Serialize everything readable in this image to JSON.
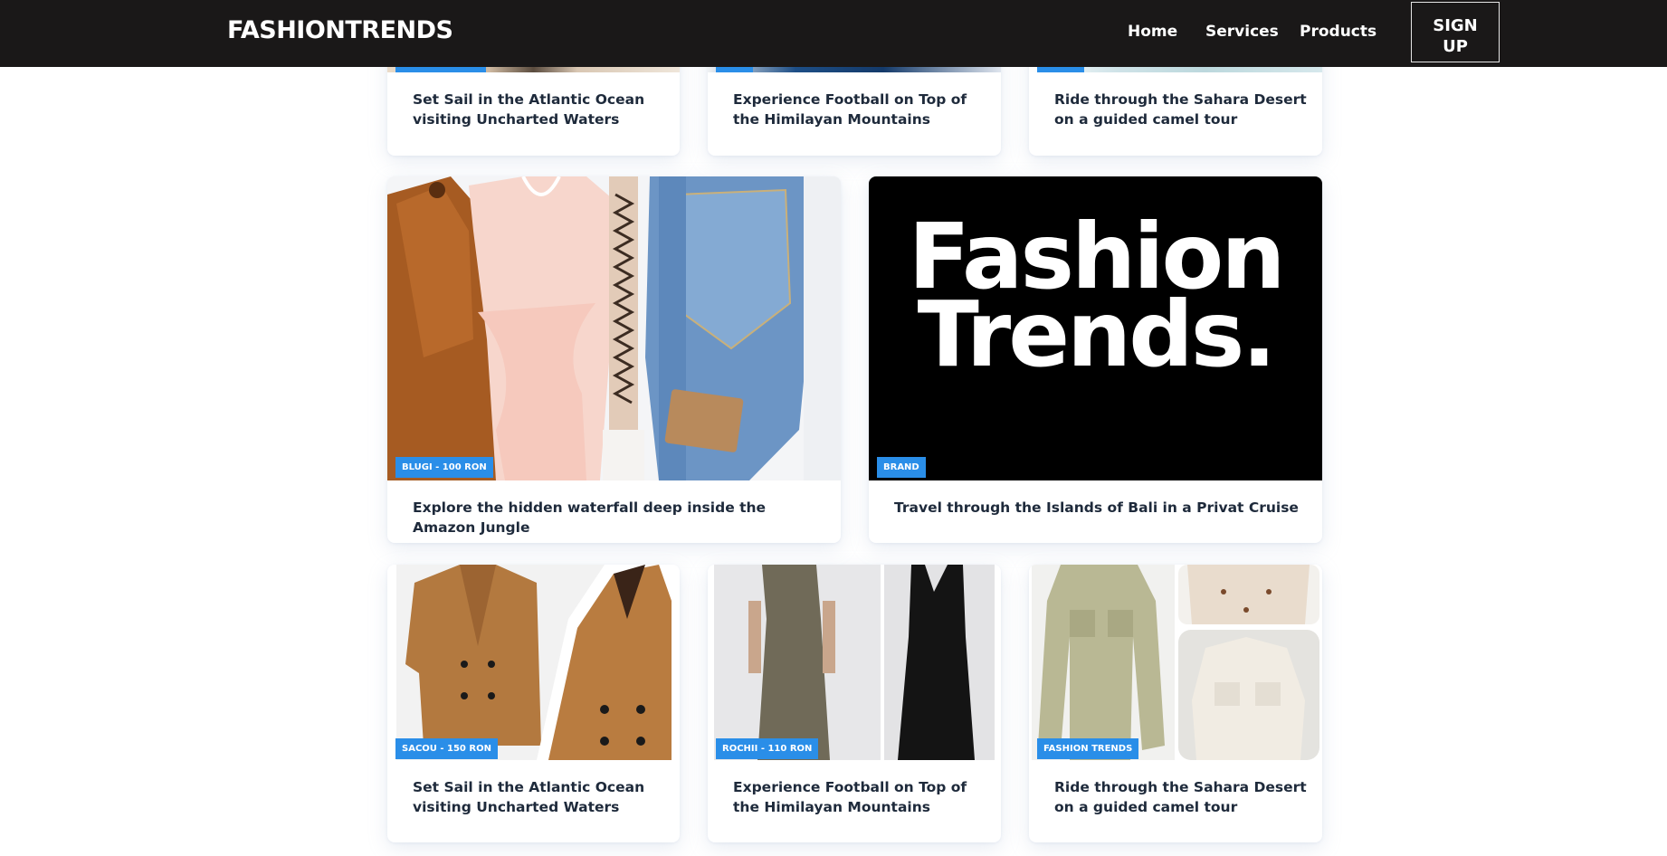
{
  "navbar": {
    "brand": "FASHIONTRENDS",
    "links": [
      "Home",
      "Services",
      "Products"
    ],
    "signup_label": "SIGN\nUP"
  },
  "top_row": [
    {
      "title": "Set Sail in the Atlantic Ocean visiting Uncharted Waters"
    },
    {
      "title": "Experience Football on Top of the Himilayan Mountains"
    },
    {
      "title": "Ride through the Sahara Desert on a guided camel tour"
    }
  ],
  "featured": [
    {
      "tag": "BLUGI - 100 RON",
      "title": "Explore the hidden waterfall deep inside the Amazon Jungle",
      "image": "clothes-rack-photo"
    },
    {
      "tag": "BRAND",
      "title": "Travel through the Islands of Bali in a Privat Cruise",
      "image_text": [
        "Fashion",
        "Trends."
      ]
    }
  ],
  "bottom_row": [
    {
      "tag": "SACOU - 150 RON",
      "title": "Set Sail in the Atlantic Ocean visiting Uncharted Waters",
      "image": "camel-blazer-photo"
    },
    {
      "tag": "ROCHII - 110 RON",
      "title": "Experience Football on Top of the Himilayan Mountains",
      "image": "dress-photo"
    },
    {
      "tag": "FASHION TRENDS",
      "title": "Ride through the Sahara Desert on a guided camel tour",
      "image": "shirt-dress-photo"
    }
  ],
  "colors": {
    "navbar_bg": "#1a1818",
    "accent_blue": "#2a8ee8",
    "title_text": "#1e2a3b"
  }
}
